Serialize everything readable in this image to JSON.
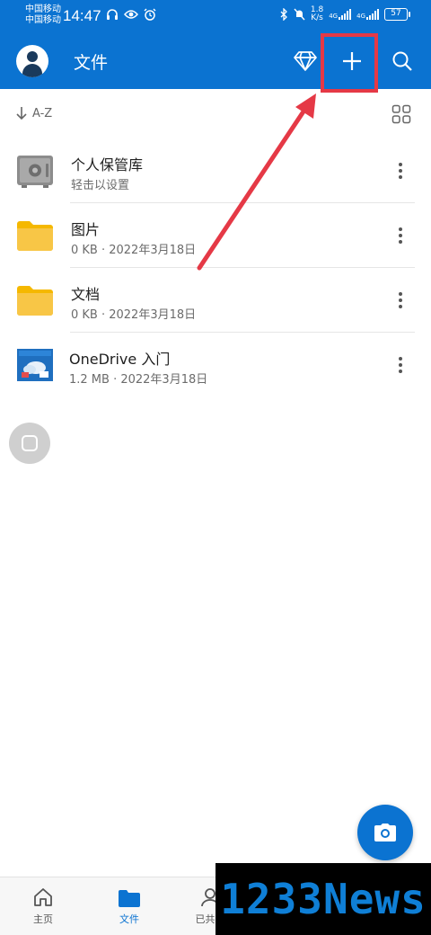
{
  "status_bar": {
    "carrier_1": "中国移动",
    "carrier_2": "中国移动",
    "time": "14:47",
    "speed_value": "1.8",
    "speed_unit": "K/s",
    "network_1": "4G",
    "network_2": "4G",
    "battery": "57"
  },
  "header": {
    "title": "文件"
  },
  "sort": {
    "label": "A-Z"
  },
  "files": [
    {
      "title": "个人保管库",
      "meta": "轻击以设置",
      "icon": "vault-icon"
    },
    {
      "title": "图片",
      "meta": "0 KB · 2022年3月18日",
      "icon": "folder-icon"
    },
    {
      "title": "文档",
      "meta": "0 KB · 2022年3月18日",
      "icon": "folder-icon"
    },
    {
      "title": "OneDrive 入门",
      "meta": "1.2 MB · 2022年3月18日",
      "icon": "document-thumbnail-icon"
    }
  ],
  "bottom_nav": {
    "home": "主页",
    "files": "文件",
    "shared": "已共享"
  },
  "watermark": "1233News",
  "colors": {
    "brand": "#0b73d1",
    "annotation": "#e53946",
    "folder": "#f8c646"
  }
}
